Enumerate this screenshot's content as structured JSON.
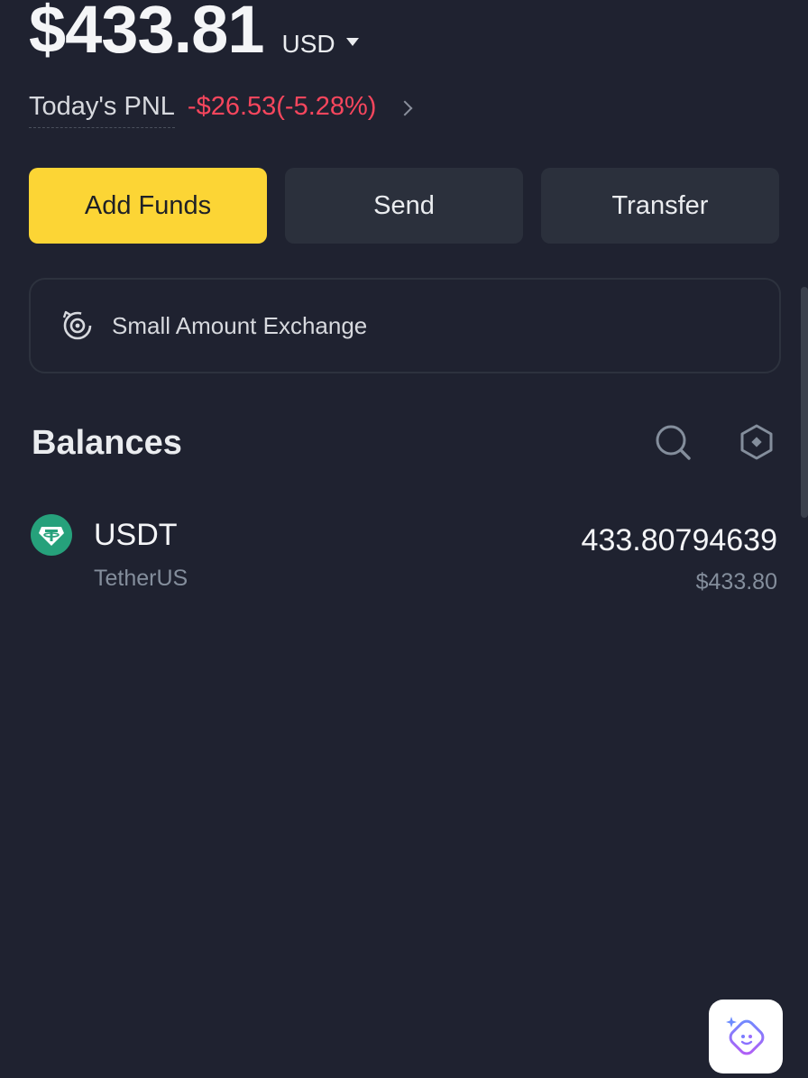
{
  "header": {
    "total_balance": "$433.81",
    "currency": "USD",
    "pnl_label": "Today's PNL",
    "pnl_value": "-$26.53(-5.28%)"
  },
  "actions": {
    "add_funds": "Add Funds",
    "send": "Send",
    "transfer": "Transfer"
  },
  "small_exchange": {
    "label": "Small Amount Exchange"
  },
  "balances": {
    "title": "Balances",
    "items": [
      {
        "symbol": "USDT",
        "name": "TetherUS",
        "amount": "433.80794639",
        "fiat_value": "$433.80",
        "icon": "tether-logo-icon"
      }
    ]
  },
  "colors": {
    "background": "#1f2230",
    "accent": "#fcd535",
    "negative": "#f6465d",
    "tether": "#26a17b"
  },
  "icons": {
    "exchange": "small-exchange-icon",
    "search": "search-icon",
    "settings": "hexagon-settings-icon",
    "assistant": "ai-assistant-icon"
  }
}
